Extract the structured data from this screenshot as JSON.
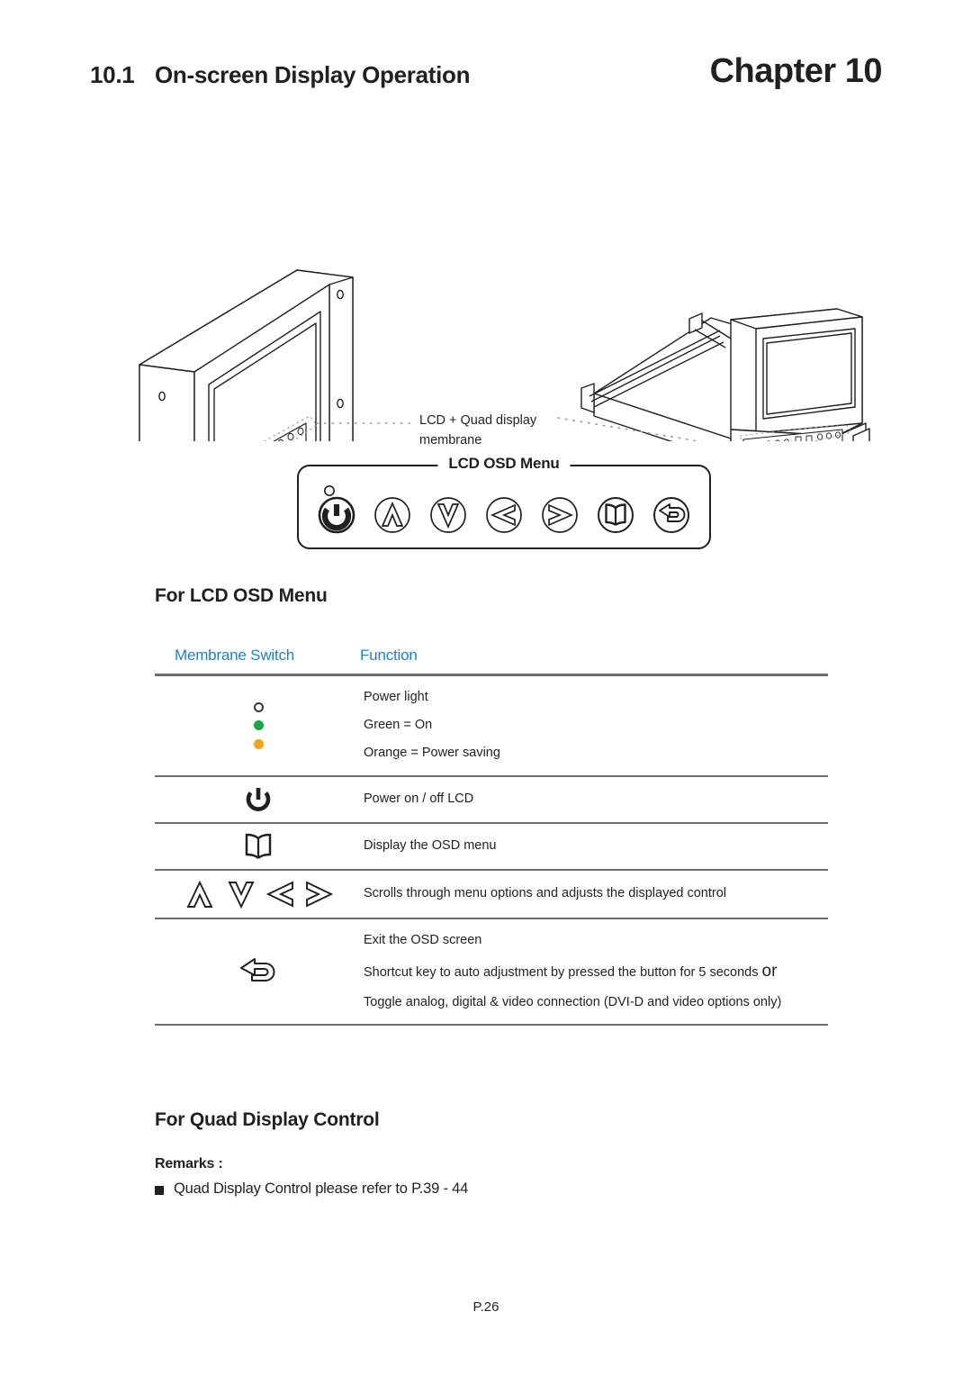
{
  "header": {
    "section_number": "10.1",
    "section_title": "On-screen Display Operation",
    "chapter": "Chapter 10"
  },
  "illustration": {
    "callout_line1": "LCD + Quad display",
    "callout_line2": "membrane",
    "left_device_name": "lcd-panel-isometric",
    "right_device_name": "rackmount-kvm-drawer-isometric"
  },
  "osd_panel": {
    "legend": "LCD OSD Menu",
    "icons": [
      {
        "name": "power-button-icon",
        "label": "Power"
      },
      {
        "name": "arrow-up-icon",
        "label": "Up"
      },
      {
        "name": "arrow-down-icon",
        "label": "Down"
      },
      {
        "name": "arrow-left-icon",
        "label": "Left"
      },
      {
        "name": "arrow-right-icon",
        "label": "Right"
      },
      {
        "name": "book-menu-icon",
        "label": "Menu"
      },
      {
        "name": "return-exit-icon",
        "label": "Exit"
      }
    ]
  },
  "sections": {
    "lcd_osd_title": "For LCD OSD Menu",
    "quad_display_title": "For Quad Display Control"
  },
  "table": {
    "headers": {
      "switch": "Membrane Switch",
      "function": "Function"
    },
    "header_color": "#1f7fc4",
    "rows": [
      {
        "switch_type": "power-light-indicators",
        "indicators": [
          {
            "name": "led-off-indicator",
            "color": "#ffffff"
          },
          {
            "name": "led-green-indicator",
            "color": "#18a64a"
          },
          {
            "name": "led-orange-indicator",
            "color": "#f5a01e"
          }
        ],
        "functions": [
          "Power light",
          "Green = On",
          "Orange = Power saving"
        ]
      },
      {
        "switch_type": "power-button-icon",
        "functions": [
          "Power on / off LCD"
        ]
      },
      {
        "switch_type": "book-menu-icon",
        "functions": [
          "Display the OSD menu"
        ]
      },
      {
        "switch_type": "navigation-arrows",
        "functions": [
          "Scrolls through menu options and adjusts the displayed control"
        ]
      },
      {
        "switch_type": "return-exit-icon",
        "functions": [
          "Exit the OSD screen",
          "Shortcut key to auto adjustment by pressed the button for 5 seconds ",
          "Toggle analog, digital & video connection (DVI-D and video options only)"
        ],
        "trailing_or": "or"
      }
    ]
  },
  "remarks": {
    "title": "Remarks :",
    "items": [
      "Quad Display Control please refer to P.39 - 44"
    ]
  },
  "footer": {
    "page": "P.26"
  }
}
